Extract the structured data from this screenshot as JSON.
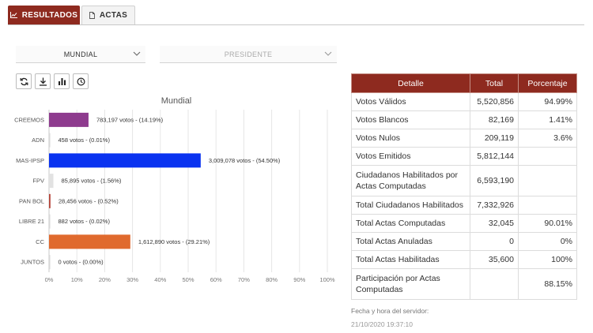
{
  "tabs": [
    {
      "label": "RESULTADOS",
      "icon": "chart-line-icon",
      "active": true
    },
    {
      "label": "ACTAS",
      "icon": "document-icon",
      "active": false
    }
  ],
  "filters": {
    "scope": "MUNDIAL",
    "election": "PRESIDENTE"
  },
  "toolbar": [
    "refresh-icon",
    "download-icon",
    "bar-chart-icon",
    "clock-icon"
  ],
  "chart_data": {
    "type": "bar",
    "orientation": "horizontal",
    "title": "Mundial",
    "categories": [
      "CREEMOS",
      "ADN",
      "MAS-IPSP",
      "FPV",
      "PAN BOL",
      "LIBRE 21",
      "CC",
      "JUNTOS"
    ],
    "values": [
      14.19,
      0.01,
      54.5,
      1.56,
      0.52,
      0.02,
      29.21,
      0.0
    ],
    "labels": [
      "783,197 votos - (14.19%)",
      "458 votos - (0.01%)",
      "3,009,078 votos - (54.50%)",
      "85,895 votos - (1.56%)",
      "28,456 votos - (0.52%)",
      "882 votos - (0.02%)",
      "1,612,890 votos - (29.21%)",
      "0 votos - (0.00%)"
    ],
    "colors": [
      "#8e3b8e",
      "#d8d8d8",
      "#0a33f0",
      "#e2e2e2",
      "#b5453a",
      "#d8d8d8",
      "#e06a2e",
      "#d8d8d8"
    ],
    "xlim": [
      0,
      100
    ],
    "xticks": [
      "0%",
      "10%",
      "20%",
      "30%",
      "40%",
      "50%",
      "60%",
      "70%",
      "80%",
      "90%",
      "100%"
    ],
    "grid": true
  },
  "table": {
    "headers": [
      "Detalle",
      "Total",
      "Porcentaje"
    ],
    "rows": [
      {
        "detalle": "Votos Válidos",
        "total": "5,520,856",
        "porcentaje": "94.99%"
      },
      {
        "detalle": "Votos Blancos",
        "total": "82,169",
        "porcentaje": "1.41%"
      },
      {
        "detalle": "Votos Nulos",
        "total": "209,119",
        "porcentaje": "3.6%"
      },
      {
        "detalle": "Votos Emitidos",
        "total": "5,812,144",
        "porcentaje": ""
      },
      {
        "detalle": "Ciudadanos Habilitados por Actas Computadas",
        "total": "6,593,190",
        "porcentaje": ""
      },
      {
        "detalle": "Total Ciudadanos Habilitados",
        "total": "7,332,926",
        "porcentaje": ""
      },
      {
        "detalle": "Total Actas Computadas",
        "total": "32,045",
        "porcentaje": "90.01%"
      },
      {
        "detalle": "Total Actas Anuladas",
        "total": "0",
        "porcentaje": "0%"
      },
      {
        "detalle": "Total Actas Habilitadas",
        "total": "35,600",
        "porcentaje": "100%"
      },
      {
        "detalle": "Participación por Actas Computadas",
        "total": "",
        "porcentaje": "88.15%"
      }
    ]
  },
  "server": {
    "label": "Fecha y hora del servidor:",
    "datetime": "21/10/2020 19:37:10"
  },
  "colors": {
    "accent": "#8e2a1f"
  }
}
